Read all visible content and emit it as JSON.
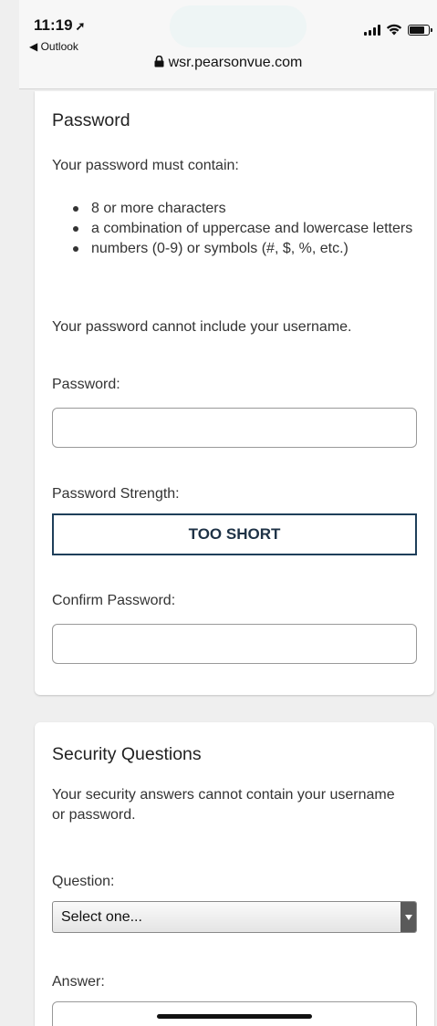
{
  "status_bar": {
    "time": "11:19",
    "back_label": "◀ Outlook",
    "url": "wsr.pearsonvue.com",
    "icons": [
      "location-arrow-icon",
      "signal-icon",
      "wifi-icon",
      "battery-icon",
      "lock-icon"
    ]
  },
  "password_section": {
    "title": "Password",
    "intro": "Your password must contain:",
    "requirements": [
      "8 or more characters",
      "a combination of uppercase and lowercase letters",
      "numbers (0-9) or symbols (#, $, %, etc.)"
    ],
    "username_note": "Your password cannot include your username.",
    "password_label": "Password:",
    "password_value": "",
    "strength_label": "Password Strength:",
    "strength_value": "TOO SHORT",
    "confirm_label": "Confirm Password:",
    "confirm_value": ""
  },
  "security_section": {
    "title": "Security Questions",
    "note": "Your security answers cannot contain your username or password.",
    "question_label": "Question:",
    "question_selected": "Select one...",
    "answer_label": "Answer:",
    "answer_value": ""
  },
  "colors": {
    "page_bg": "#efefef",
    "card_bg": "#ffffff",
    "strength_border": "#1f3f5a",
    "text": "#333333"
  }
}
